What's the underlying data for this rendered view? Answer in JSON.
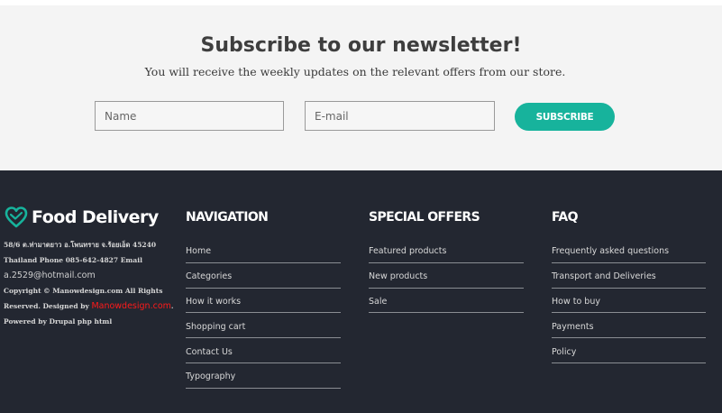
{
  "newsletter": {
    "title": "Subscribe to our newsletter!",
    "subtitle": "You will receive the weekly updates on the relevant offers from our store.",
    "name_placeholder": "Name",
    "email_placeholder": "E-mail",
    "subscribe_label": "SUBSCRIBE",
    "accent_color": "#17b39c"
  },
  "brand": {
    "name": "Food Delivery",
    "icon": "heart-icon",
    "icon_color": "#17b39c"
  },
  "contact": {
    "address": "58/6 ต.ท่ามาตยาว อ.โพนทราย จ.ร้อยเอ็ด 45240",
    "phone_line": "Thailand Phone 085-642-4827 Email",
    "email": "a.2529@hotmail.com",
    "copyright_prefix": "Copyright © Manowdesign.com All Rights Reserved. Designed by ",
    "designer_link": "Manowdesign.com",
    "copyright_suffix": ".",
    "powered_by": "Powered by Drupal php html"
  },
  "footer": {
    "navigation": {
      "title": "NAVIGATION",
      "items": [
        "Home",
        "Categories",
        "How it works",
        "Shopping cart",
        "Contact Us",
        "Typography"
      ]
    },
    "special_offers": {
      "title": "SPECIAL OFFERS",
      "items": [
        "Featured products",
        "New products",
        "Sale"
      ]
    },
    "faq": {
      "title": "FAQ",
      "items": [
        "Frequently asked questions",
        "Transport and Deliveries",
        "How to buy",
        "Payments",
        "Policy"
      ]
    },
    "background_color": "#232731"
  }
}
